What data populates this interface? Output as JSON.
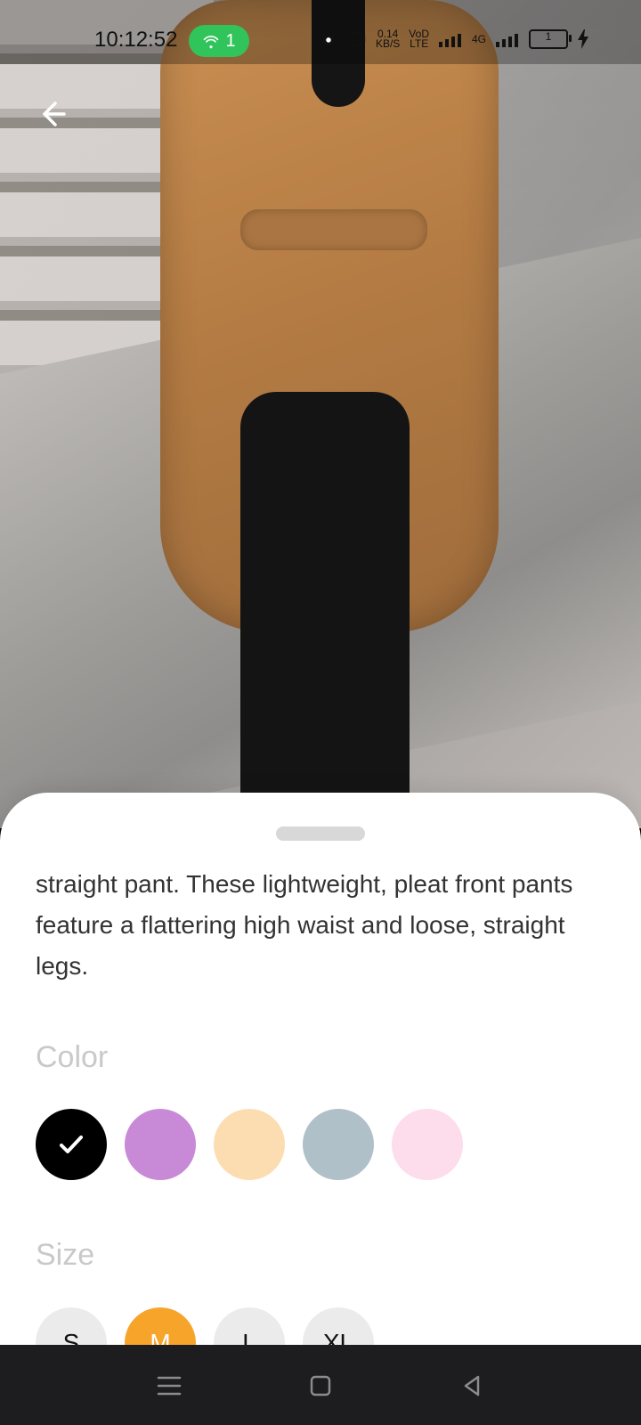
{
  "status_bar": {
    "time": "10:12:52",
    "hotspot_count": "1",
    "data_speed_value": "0.14",
    "data_speed_unit": "KB/S",
    "volte_line1": "VoD",
    "volte_line2": "LTE",
    "network_label": "4G",
    "battery_level_text": "1"
  },
  "product": {
    "description": "straight pant. These lightweight, pleat front pants feature a flattering high waist and loose, straight legs.",
    "color_title": "Color",
    "colors": [
      {
        "name": "black",
        "hex": "#000000",
        "selected": true
      },
      {
        "name": "purple",
        "hex": "#C88AD7",
        "selected": false
      },
      {
        "name": "peach",
        "hex": "#FCDDB2",
        "selected": false
      },
      {
        "name": "blue-gray",
        "hex": "#AFC0C8",
        "selected": false
      },
      {
        "name": "pink",
        "hex": "#FDDCEB",
        "selected": false
      }
    ],
    "size_title": "Size",
    "sizes": [
      {
        "label": "S",
        "selected": false
      },
      {
        "label": "M",
        "selected": true
      },
      {
        "label": "L",
        "selected": false
      },
      {
        "label": "XL",
        "selected": false
      }
    ],
    "accent_color": "#F7A42A"
  }
}
